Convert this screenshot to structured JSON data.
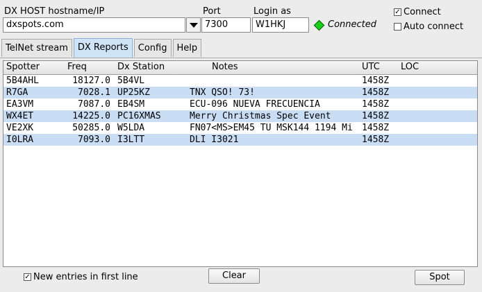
{
  "connection": {
    "host_label": "DX HOST hostname/IP",
    "host_value": "dxspots.com",
    "port_label": "Port",
    "port_value": "7300",
    "login_label": "Login as",
    "login_value": "W1HKJ",
    "status": "Connected",
    "status_color": "#19d019",
    "connect_label": "Connect",
    "connect_checked": true,
    "auto_connect_label": "Auto connect",
    "auto_connect_checked": false
  },
  "tabs": [
    {
      "label": "TelNet stream",
      "active": false
    },
    {
      "label": "DX Reports",
      "active": true
    },
    {
      "label": "Config",
      "active": false
    },
    {
      "label": "Help",
      "active": false
    }
  ],
  "table": {
    "columns": [
      "Spotter",
      "Freq",
      "Dx Station",
      "Notes",
      "UTC",
      "LOC"
    ],
    "rows": [
      {
        "spotter": "5B4AHL",
        "freq": "18127.0",
        "dx": "5B4VL",
        "notes": "",
        "utc": "1458Z",
        "loc": ""
      },
      {
        "spotter": "R7GA",
        "freq": "7028.1",
        "dx": "UP25KZ",
        "notes": "TNX QSO! 73!",
        "utc": "1458Z",
        "loc": ""
      },
      {
        "spotter": "EA3VM",
        "freq": "7087.0",
        "dx": "EB4SM",
        "notes": "ECU-096 NUEVA FRECUENCIA",
        "utc": "1458Z",
        "loc": ""
      },
      {
        "spotter": "WX4ET",
        "freq": "14225.0",
        "dx": "PC16XMAS",
        "notes": "Merry Christmas Spec Event",
        "utc": "1458Z",
        "loc": ""
      },
      {
        "spotter": "VE2XK",
        "freq": "50285.0",
        "dx": "W5LDA",
        "notes": "FN07<MS>EM45 TU MSK144 1194 Mi",
        "utc": "1458Z",
        "loc": ""
      },
      {
        "spotter": "I0LRA",
        "freq": "7093.0",
        "dx": "I3LTT",
        "notes": "DLI I3021",
        "utc": "1458Z",
        "loc": ""
      }
    ],
    "alt_row_color": "#c9def5"
  },
  "footer": {
    "new_entries_label": "New entries in first line",
    "new_entries_checked": true,
    "clear_label": "Clear",
    "spot_label": "Spot"
  }
}
